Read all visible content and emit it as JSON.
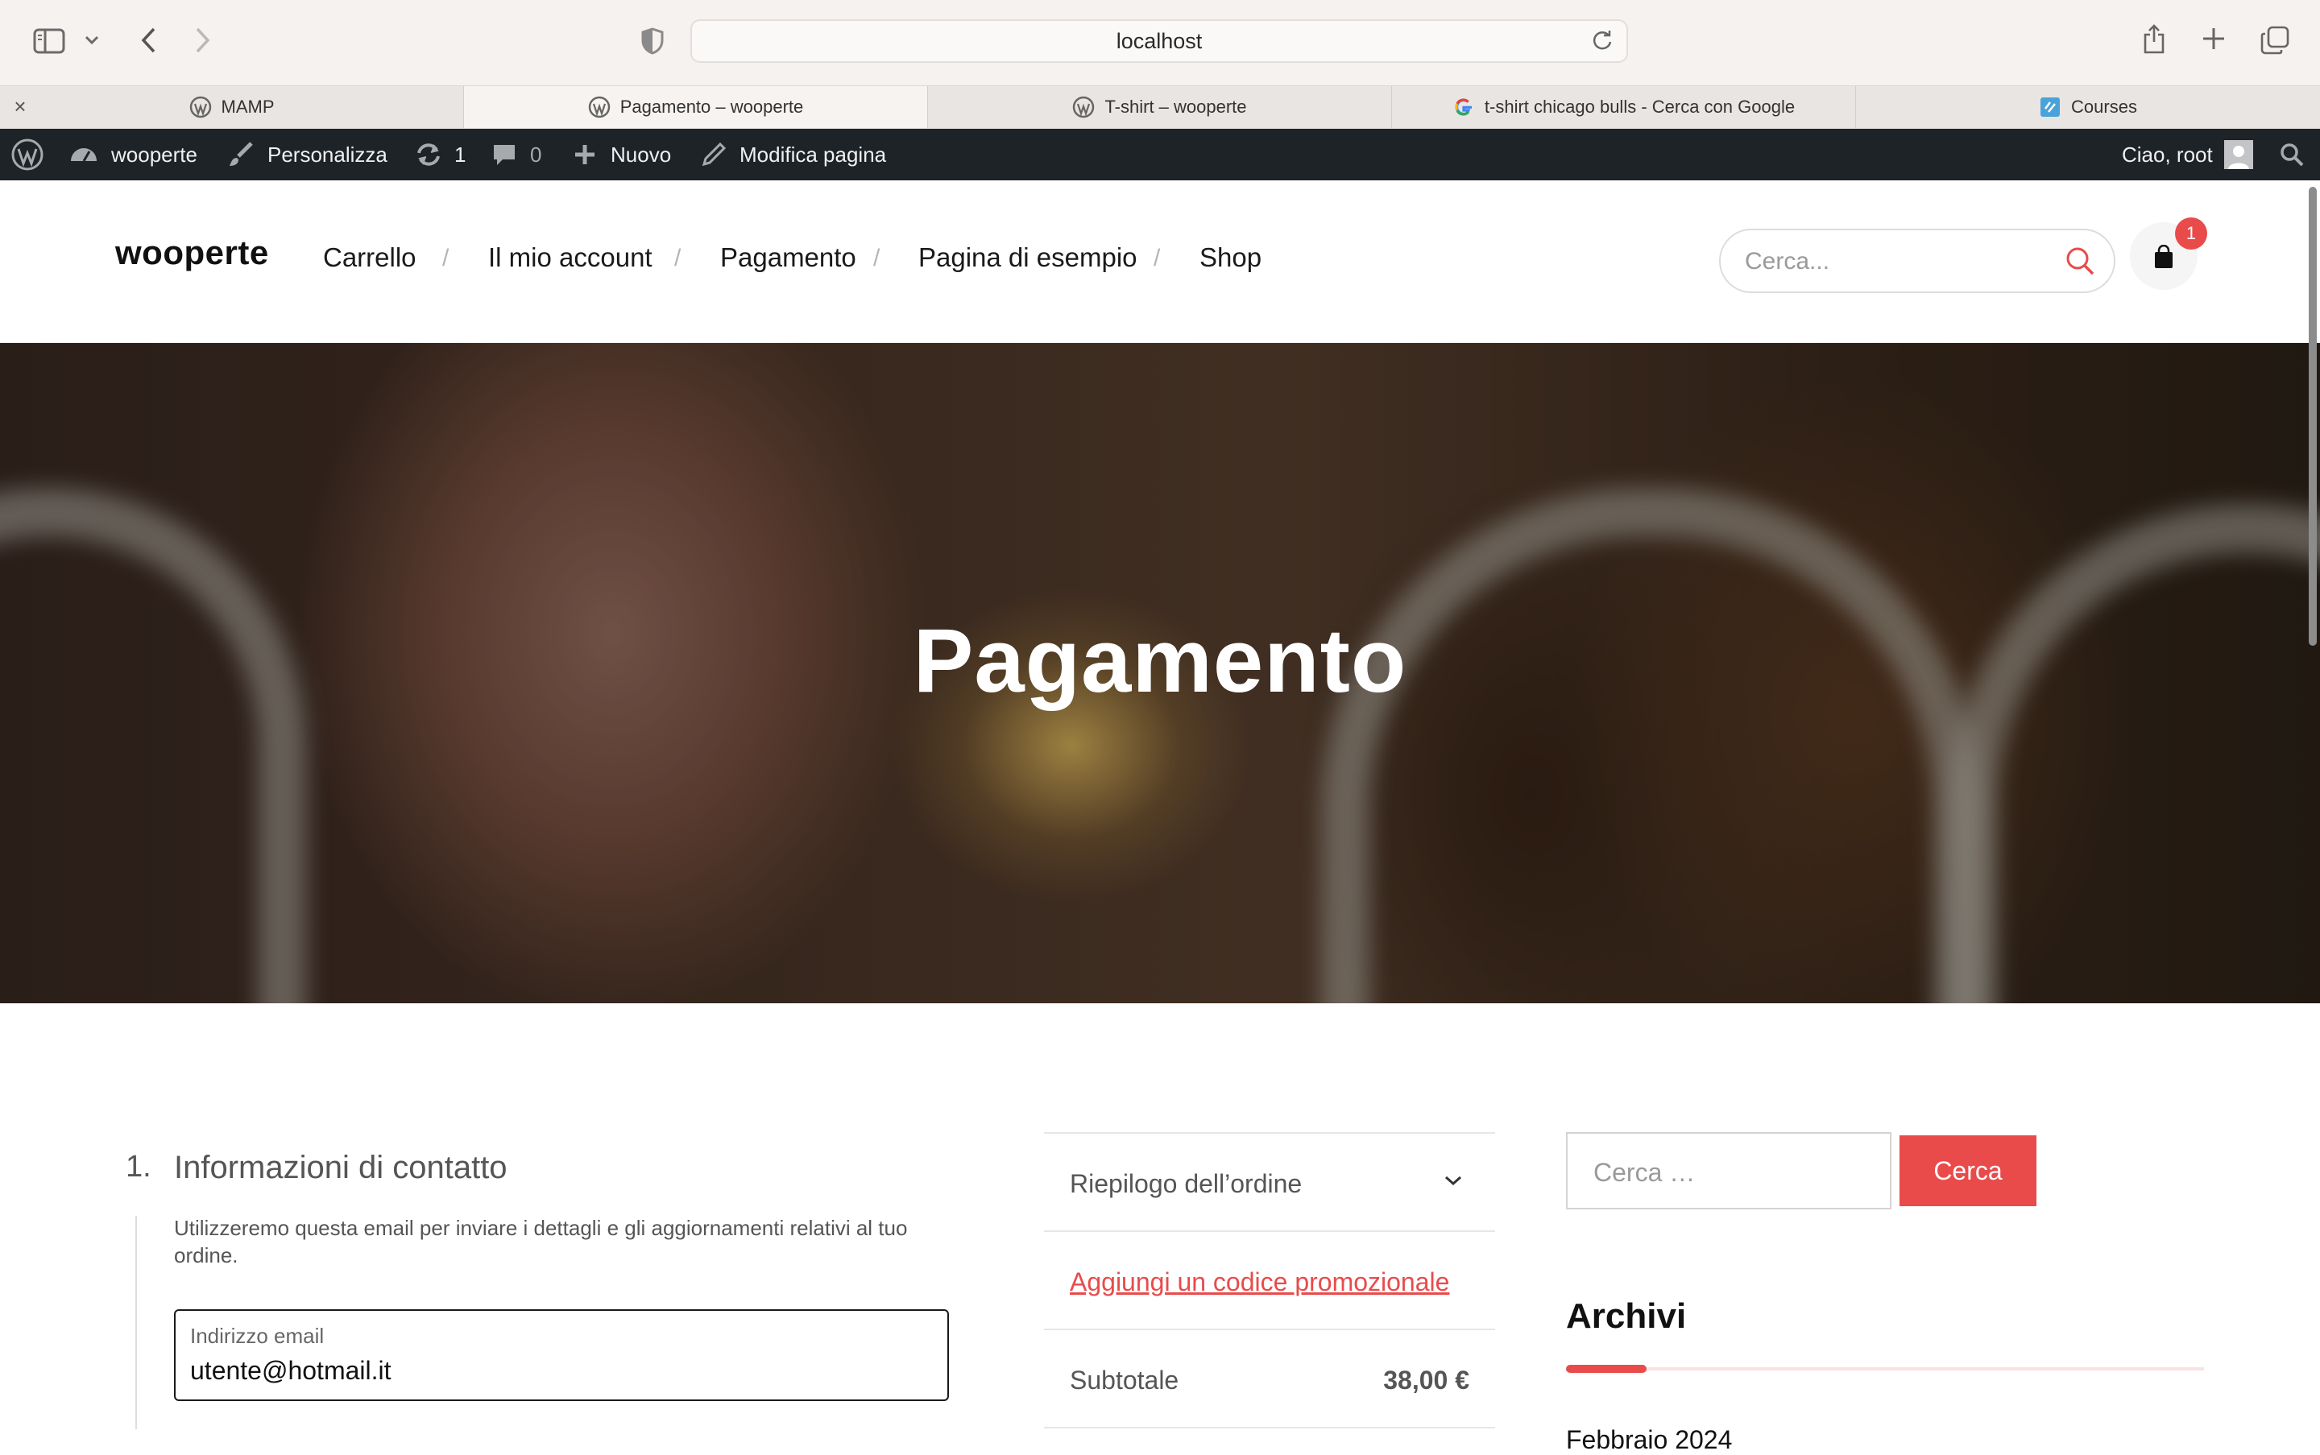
{
  "browser": {
    "url": "localhost",
    "tabs": [
      {
        "label": "MAMP",
        "active": false
      },
      {
        "label": "Pagamento – wooperte",
        "active": true
      },
      {
        "label": "T-shirt – wooperte",
        "active": false
      },
      {
        "label": "t-shirt chicago bulls - Cerca con Google",
        "active": false
      },
      {
        "label": "Courses",
        "active": false
      }
    ],
    "close_tab_glyph": "×"
  },
  "adminbar": {
    "site_name": "wooperte",
    "customize": "Personalizza",
    "updates_count": "1",
    "comments_count": "0",
    "new": "Nuovo",
    "edit_page": "Modifica pagina",
    "greeting": "Ciao, root"
  },
  "header": {
    "logo": "wooperte",
    "nav": [
      "Carrello",
      "Il mio account",
      "Pagamento",
      "Pagina di esempio",
      "Shop"
    ],
    "nav_separator": "/",
    "search_placeholder": "Cerca...",
    "cart_count": "1"
  },
  "hero": {
    "title": "Pagamento"
  },
  "checkout": {
    "step_number": "1.",
    "step_title": "Informazioni di contatto",
    "step_description": "Utilizzeremo questa email per inviare i dettagli e gli aggiornamenti relativi al tuo ordine.",
    "email_label": "Indirizzo email",
    "email_value": "utente@hotmail.it"
  },
  "order_summary": {
    "title": "Riepilogo dell’ordine",
    "promo_link": "Aggiungi un codice promozionale",
    "subtotal_label": "Subtotale",
    "subtotal_value": "38,00 €"
  },
  "sidebar": {
    "search_placeholder": "Cerca …",
    "search_button": "Cerca",
    "archives_title": "Archivi",
    "archives": [
      "Febbraio 2024"
    ]
  },
  "colors": {
    "accent": "#e94b4b",
    "adminbar": "#1d2327"
  }
}
